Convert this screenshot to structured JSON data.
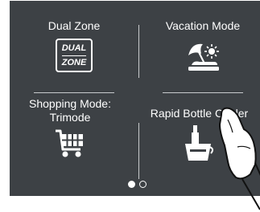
{
  "tiles": {
    "dual_zone": {
      "label": "Dual Zone",
      "icon_line1": "DUAL",
      "icon_line2": "ZONE",
      "icon": "dual-zone-icon"
    },
    "vacation": {
      "label": "Vacation Mode",
      "icon": "beach-umbrella-sun-icon"
    },
    "shopping": {
      "label_line1": "Shopping Mode:",
      "label_line2": "Trimode",
      "icon": "shopping-cart-icon"
    },
    "rapid_bottle": {
      "label": "Rapid Bottle Cooler",
      "icon": "bottle-ice-bucket-icon"
    }
  },
  "pagination": {
    "pages": 2,
    "current": 1
  },
  "colors": {
    "panel": "#3d4145",
    "text": "#ffffff",
    "divider": "#c9cbcd"
  }
}
